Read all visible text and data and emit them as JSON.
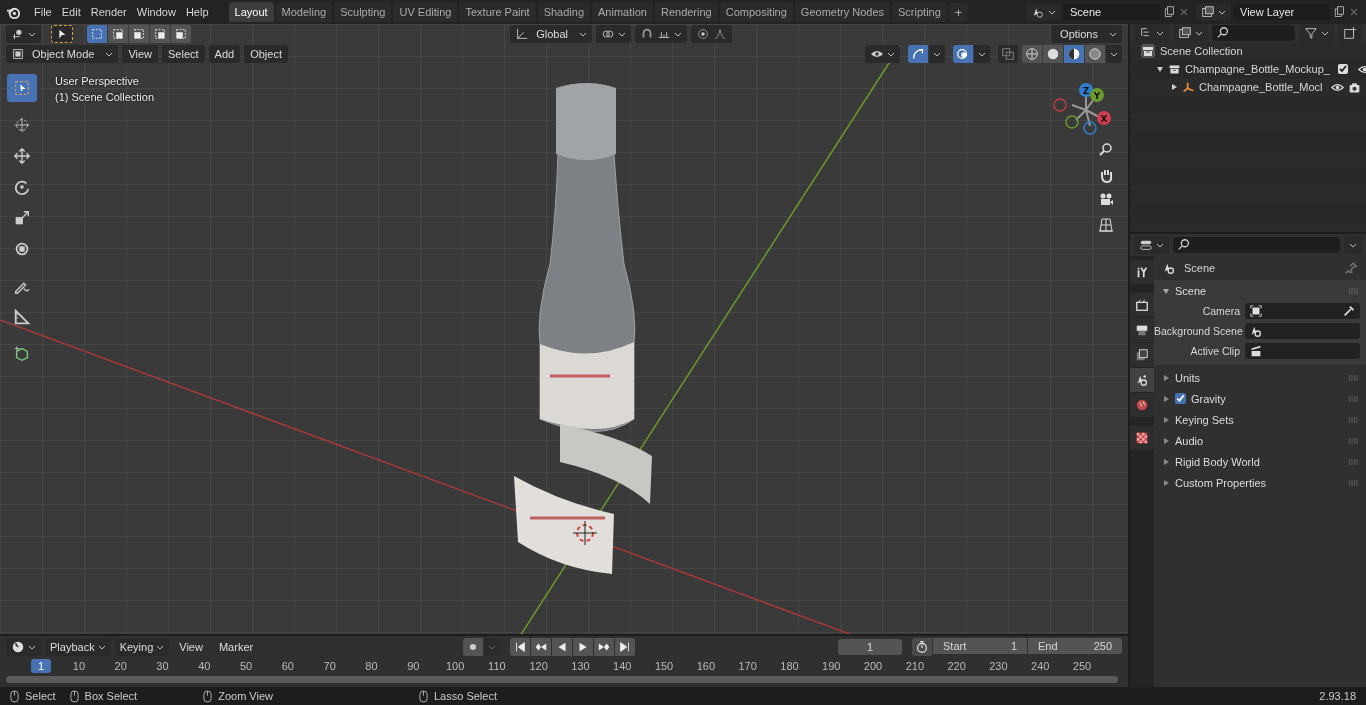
{
  "menu": [
    {
      "label": "File"
    },
    {
      "label": "Edit"
    },
    {
      "label": "Render"
    },
    {
      "label": "Window"
    },
    {
      "label": "Help"
    }
  ],
  "workspaces": [
    {
      "label": "Layout",
      "selected": true
    },
    {
      "label": "Modeling",
      "selected": false
    },
    {
      "label": "Sculpting",
      "selected": false
    },
    {
      "label": "UV Editing",
      "selected": false
    },
    {
      "label": "Texture Paint",
      "selected": false
    },
    {
      "label": "Shading",
      "selected": false
    },
    {
      "label": "Animation",
      "selected": false
    },
    {
      "label": "Rendering",
      "selected": false
    },
    {
      "label": "Compositing",
      "selected": false
    },
    {
      "label": "Geometry Nodes",
      "selected": false
    },
    {
      "label": "Scripting",
      "selected": false
    }
  ],
  "add_workspace": "+",
  "scene_field": {
    "value": "Scene"
  },
  "view_layer_field": {
    "value": "View Layer"
  },
  "viewport": {
    "mode": "Object Mode",
    "menus": [
      "View",
      "Select",
      "Add",
      "Object"
    ],
    "orientation": "Global",
    "options": "Options",
    "select_modes": [
      {
        "selected": true
      },
      {
        "selected": false
      },
      {
        "selected": false
      },
      {
        "selected": false
      },
      {
        "selected": false
      }
    ],
    "overlay_text": [
      "User Perspective",
      "(1) Scene Collection"
    ],
    "tools": [
      {
        "kind": "select",
        "selected": true
      },
      {
        "kind": "cursor",
        "selected": false
      },
      {
        "kind": "move",
        "selected": false
      },
      {
        "kind": "rotate",
        "selected": false
      },
      {
        "kind": "scale",
        "selected": false
      },
      {
        "kind": "transform",
        "selected": false
      },
      {
        "kind": "annotate",
        "selected": false
      },
      {
        "kind": "measure",
        "selected": false
      },
      {
        "kind": "add_cube",
        "selected": false
      }
    ],
    "toggles": [
      {
        "kind": "gizmos",
        "on": true
      },
      {
        "kind": "overlays",
        "on": true
      },
      {
        "kind": "xray",
        "on": false
      }
    ],
    "shading": [
      {
        "kind": "wireframe",
        "selected": false
      },
      {
        "kind": "solid",
        "selected": false
      },
      {
        "kind": "material",
        "selected": true
      },
      {
        "kind": "rendered",
        "selected": false
      }
    ],
    "gizmo_labels": [
      "Z",
      "Y",
      "X"
    ]
  },
  "outliner": {
    "items": [
      {
        "label": "Scene Collection",
        "kind": "scene",
        "children": [
          {
            "label": "Champagne_Bottle_Mockup_",
            "kind": "collection",
            "expanded": true,
            "checked": true,
            "children": [
              {
                "label": "Champagne_Bottle_Mocl",
                "kind": "empty",
                "expanded": false
              }
            ]
          }
        ]
      }
    ]
  },
  "properties": {
    "tabs": [
      {
        "kind": "tool",
        "selected": false
      },
      {
        "kind": "render",
        "selected": false
      },
      {
        "kind": "output",
        "selected": false
      },
      {
        "kind": "view_layer",
        "selected": false
      },
      {
        "kind": "scene",
        "selected": true
      },
      {
        "kind": "world",
        "selected": false
      },
      {
        "kind": "texture",
        "selected": false
      }
    ],
    "context": "Scene",
    "panel": {
      "title": "Scene",
      "expanded": true,
      "fields": [
        {
          "label": "Camera",
          "kind": "camera"
        },
        {
          "label": "Background Scene",
          "kind": "scene"
        },
        {
          "label": "Active Clip",
          "kind": "clip"
        }
      ]
    },
    "sections": [
      {
        "label": "Units",
        "expanded": false
      },
      {
        "label": "Gravity",
        "expanded": false,
        "checked": true
      },
      {
        "label": "Keying Sets",
        "expanded": false
      },
      {
        "label": "Audio",
        "expanded": false
      },
      {
        "label": "Rigid Body World",
        "expanded": false
      },
      {
        "label": "Custom Properties",
        "expanded": false
      }
    ]
  },
  "timeline": {
    "menus": [
      {
        "label": "Playback",
        "kind": "dropdown"
      },
      {
        "label": "Keying",
        "kind": "dropdown"
      },
      {
        "label": "View",
        "kind": "menu"
      },
      {
        "label": "Marker",
        "kind": "menu"
      }
    ],
    "current_frame": "1",
    "start": {
      "label": "Start",
      "value": "1"
    },
    "end": {
      "label": "End",
      "value": "250"
    },
    "playhead": "1",
    "ruler": [
      "10",
      "20",
      "30",
      "40",
      "50",
      "60",
      "70",
      "80",
      "90",
      "100",
      "110",
      "120",
      "130",
      "140",
      "150",
      "160",
      "170",
      "180",
      "190",
      "200",
      "210",
      "220",
      "230",
      "240",
      "250"
    ]
  },
  "status_bar": {
    "hints": [
      "Select",
      "Box Select",
      "Zoom View",
      "Lasso Select"
    ],
    "version": "2.93.18"
  }
}
